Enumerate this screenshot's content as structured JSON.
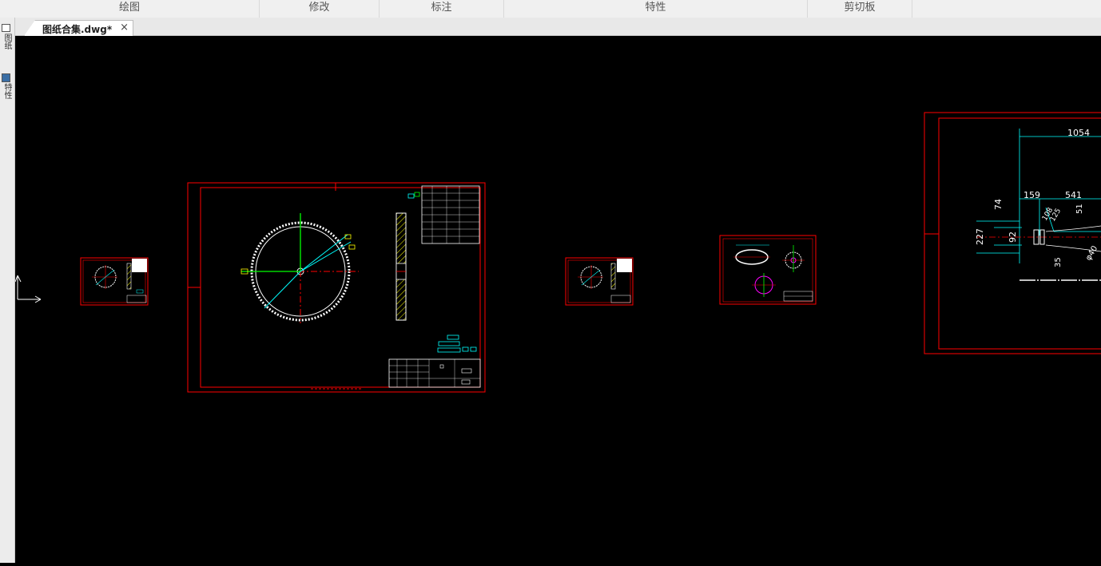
{
  "ribbon": {
    "groups": [
      "绘图",
      "修改",
      "标注",
      "特性",
      "剪切板"
    ]
  },
  "document_tab": {
    "title": "图纸合集.dwg*",
    "close_glyph": "×"
  },
  "left_panel": {
    "items": [
      "图纸",
      "特性"
    ]
  },
  "drawing": {
    "colors": {
      "background": "#000000",
      "frame": "#ff0000",
      "geometry": "#ffffff",
      "centerline": "#00ff00",
      "dimension": "#00ffff",
      "hatch": "#ffff00"
    },
    "dimensions": [
      "1054",
      "159",
      "541",
      "74",
      "227",
      "92",
      "51",
      "35",
      "108",
      "125",
      "φ40"
    ]
  }
}
